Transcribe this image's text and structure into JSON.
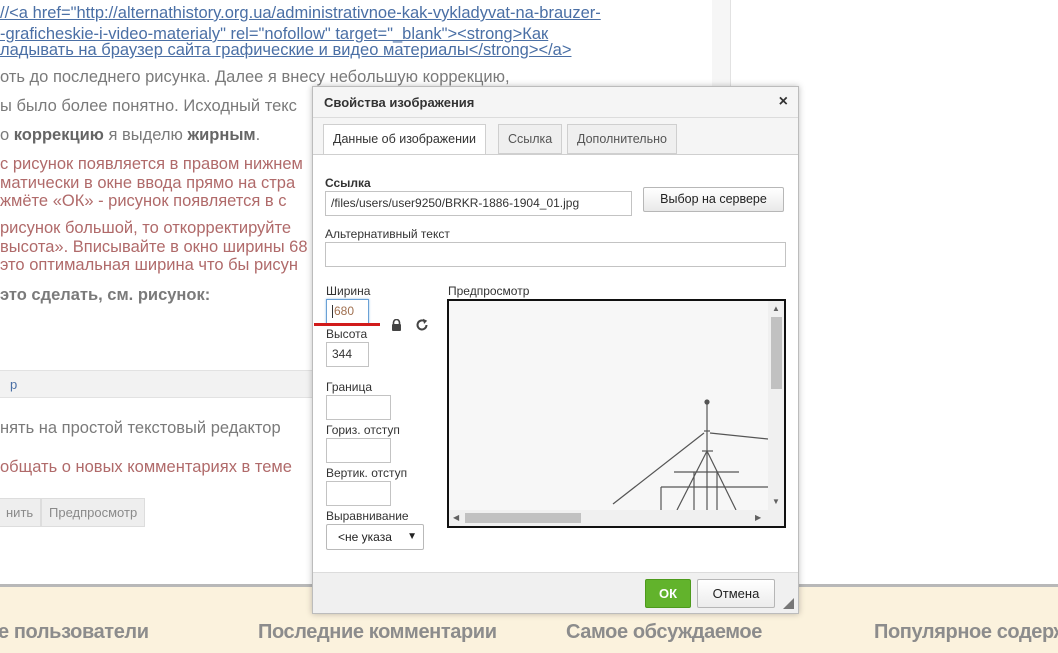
{
  "background": {
    "code_lines": [
      "//<a href=\"http://alternathistory.org.ua/administrativnoe-kak-vykladyvat-na-brauzer-",
      "-graficheskie-i-video-materialy\" rel=\"nofollow\" target=\"_blank\"><strong>Как",
      "ладывать на браузер сайта графические и видео материалы</strong></a>"
    ],
    "text_lines": [
      "оть до последнего рисунка. Далее я внесу небольшую коррекцию,",
      "ы было более понятно. Исходный текс"
    ],
    "bold_line": {
      "pre": "о ",
      "bold1": "коррекцию",
      "mid": " я выделю ",
      "bold2": "жирным",
      "post": "."
    },
    "text_lines2": [
      "с рисунок появляется в правом нижнем",
      "матически в окне ввода прямо на стра",
      "жмёте «ОК» - рисунок появляется в с"
    ],
    "text_lines3": [
      "рисунок большой, то откорректируйте",
      "высота». Вписывайте в окно ширины 68",
      "это оптимальная ширина что бы рисун"
    ],
    "heading": " это сделать, см. рисунок:",
    "toolbar_p": "p",
    "editor_switch": "нять на простой текстовый редактор",
    "notify": "общать о новых комментариях в теме",
    "save_button": "нить",
    "preview_button": "Предпросмотр"
  },
  "footer": {
    "items": [
      "е пользователи",
      "Последние комментарии",
      "Самое обсуждаемое",
      "Популярное содерж"
    ]
  },
  "dialog": {
    "title": "Свойства изображения",
    "close_icon": "×",
    "tabs": [
      "Данные об изображении",
      "Ссылка",
      "Дополнительно"
    ],
    "url_label": "Ссылка",
    "url_value": "/files/users/user9250/BRKR-1886-1904_01.jpg",
    "browse_server_label": "Выбор на сервере",
    "alt_label": "Альтернативный текст",
    "alt_value": "",
    "width_label": "Ширина",
    "width_value": "680",
    "height_label": "Высота",
    "height_value": "344",
    "border_label": "Граница",
    "border_value": "",
    "hspace_label": "Гориз. отступ",
    "hspace_value": "",
    "vspace_label": "Вертик. отступ",
    "vspace_value": "",
    "align_label": "Выравнивание",
    "align_value": "<не указа",
    "preview_label": "Предпросмотр",
    "ok_label": "ОК",
    "cancel_label": "Отмена"
  }
}
